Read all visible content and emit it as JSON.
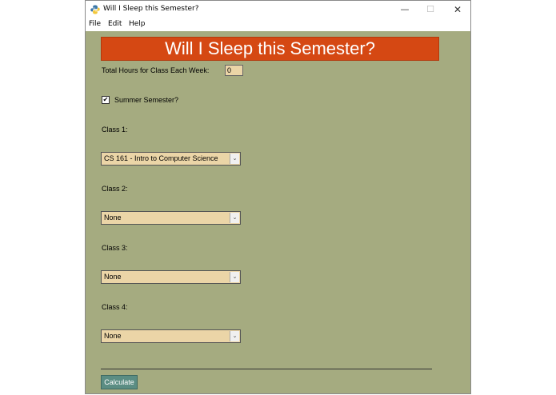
{
  "window": {
    "title": "Will I Sleep this Semester?",
    "controls": {
      "minimize": "—",
      "maximize": "☐",
      "close": "✕"
    }
  },
  "menu": [
    "File",
    "Edit",
    "Help"
  ],
  "banner": {
    "text": "Will I Sleep this Semester?",
    "color": "#d54813"
  },
  "hours": {
    "label": "Total Hours for Class Each Week:",
    "value": "0"
  },
  "summer": {
    "label": "Summer Semester?",
    "checked": true,
    "mark": "✔"
  },
  "classes": [
    {
      "label": "Class 1:",
      "selected": "CS 161 - Intro to Computer Science"
    },
    {
      "label": "Class 2:",
      "selected": "None"
    },
    {
      "label": "Class 3:",
      "selected": "None"
    },
    {
      "label": "Class 4:",
      "selected": "None"
    }
  ],
  "dropdown_arrow": "⌄",
  "calculate": {
    "label": "Calculate"
  },
  "colors": {
    "background": "#a5ab80",
    "field": "#ebd5a7",
    "button": "#5b8d83"
  }
}
